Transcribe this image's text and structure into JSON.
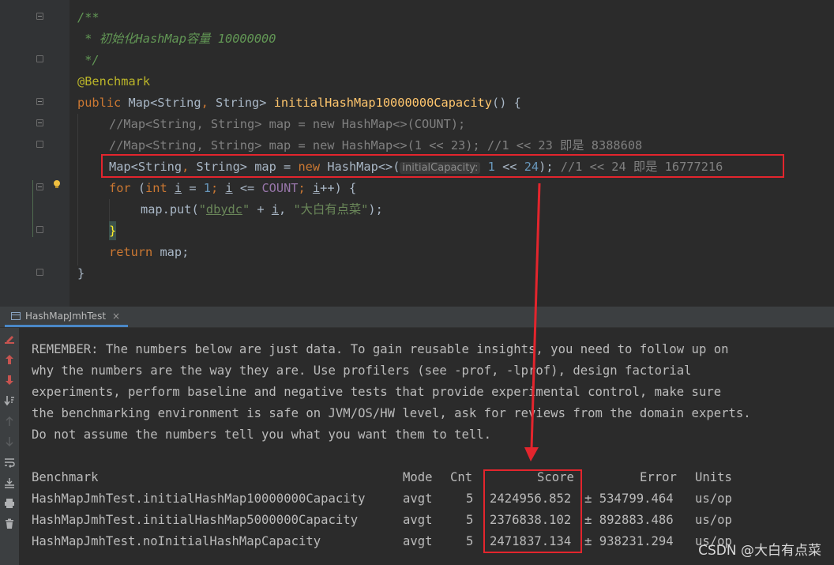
{
  "editor": {
    "lines": [
      {
        "t": "/**"
      },
      {
        "t": " * 初始化HashMap容量 10000000"
      },
      {
        "t": " */"
      },
      {
        "t": "@Benchmark"
      },
      {
        "kw": "public ",
        "type": "Map<String",
        "comma": ", ",
        "type2": "String> ",
        "method": "initialHashMap10000000Capacity",
        "rest": "() {"
      },
      {
        "t": "//Map<String, String> map = new HashMap<>(COUNT);"
      },
      {
        "t": "//Map<String, String> map = new HashMap<>(1 << 23); //1 << 23 即是 8388608"
      },
      {
        "pre": "Map<String",
        "c1": ", ",
        "mid": "String> map = ",
        "kw": "new ",
        "post": "HashMap<>(",
        "hint": "initialCapacity:",
        "sp": " ",
        "num1": "1",
        "op": " << ",
        "num2": "24",
        "end": "); ",
        "cmt": "//1 << 24 即是 16777216"
      },
      {
        "kw": "for ",
        "p1": "(",
        "kw2": "int ",
        "var": "i",
        "p2": " = ",
        "n1": "1",
        "p3": "; ",
        "var2": "i",
        "p4": " <= ",
        "const": "COUNT",
        "p5": "; ",
        "var3": "i",
        "p6": "++) {"
      },
      {
        "pre": "map.put(",
        "s1": "\"",
        "s1u": "dbydc",
        "s1e": "\"",
        "p1": " + ",
        "var": "i",
        "p2": ", ",
        "s2": "\"大白有点菜\"",
        "end": ");"
      },
      {
        "t": "}"
      },
      {
        "kw": "return ",
        "rest": "map;"
      },
      {
        "t": "}"
      }
    ]
  },
  "toolwindow": {
    "tab_label": "HashMapJmhTest",
    "tab_close": "×"
  },
  "console": {
    "remember": [
      "REMEMBER: The numbers below are just data. To gain reusable insights, you need to follow up on",
      "why the numbers are the way they are. Use profilers (see -prof, -lprof), design factorial",
      "experiments, perform baseline and negative tests that provide experimental control, make sure",
      "the benchmarking environment is safe on JVM/OS/HW level, ask for reviews from the domain experts.",
      "Do not assume the numbers tell you what you want them to tell."
    ],
    "table": {
      "headers": [
        "Benchmark",
        "Mode",
        "Cnt",
        "Score",
        "Error",
        "Units"
      ],
      "rows": [
        [
          "HashMapJmhTest.initialHashMap10000000Capacity",
          "avgt",
          "5",
          "2424956.852",
          "± 534799.464",
          "us/op"
        ],
        [
          "HashMapJmhTest.initialHashMap5000000Capacity",
          "avgt",
          "5",
          "2376838.102",
          "± 892883.486",
          "us/op"
        ],
        [
          "HashMapJmhTest.noInitialHashMapCapacity",
          "avgt",
          "5",
          "2471837.134",
          "± 938231.294",
          "us/op"
        ]
      ]
    }
  },
  "watermark": "CSDN @大白有点菜",
  "colors": {
    "highlight_box": "#e3252d",
    "keyword": "#cc7832",
    "method": "#ffc66d",
    "comment": "#629755"
  },
  "icons": [
    "fold-marker-icon",
    "lightbulb-icon",
    "stop-icon",
    "arrow-up-icon",
    "arrow-down-icon",
    "sort-icon",
    "soft-wrap-icon",
    "scroll-to-end-icon",
    "print-icon",
    "trash-icon",
    "console-tab-icon"
  ]
}
